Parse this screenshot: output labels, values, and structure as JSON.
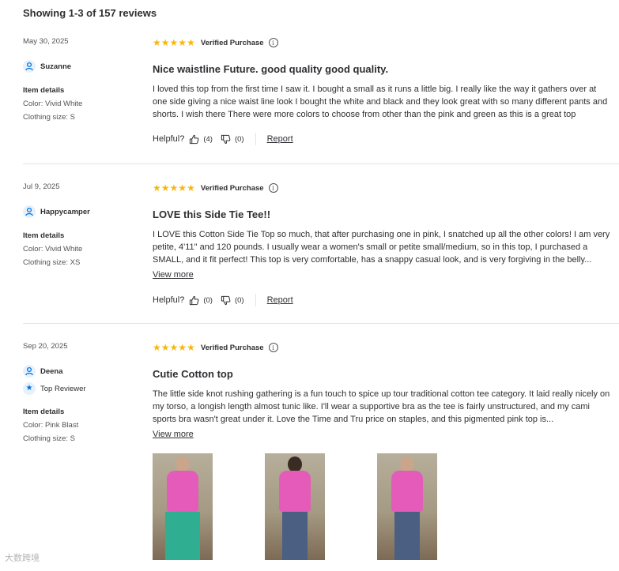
{
  "summary": "Showing 1-3 of 157 reviews",
  "icons": {
    "user": "user-icon",
    "badge": "star-badge-icon",
    "info": "info-icon",
    "thumbs_up": "thumbs-up-icon",
    "thumbs_down": "thumbs-down-icon"
  },
  "colors": {
    "star": "#f8b70b",
    "accent": "#0071dc"
  },
  "reviews": [
    {
      "date": "May 30, 2025",
      "user": "Suzanne",
      "badge": "",
      "details_heading": "Item details",
      "color": "Color: Vivid White",
      "size": "Clothing size: S",
      "rating": 5,
      "verified": "Verified Purchase",
      "title": "Nice waistline Future. good quality good quality.",
      "body": "I loved this top from the first time I saw it. I bought a small as it runs a little big. I really like the way it gathers over at one side giving a nice waist line look I bought the white and black and they look great with so many different pants and shorts. I wish there There were more colors to choose from other than the pink and green as this is a great top",
      "view_more": "",
      "helpful_label": "Helpful?",
      "up_count": "(4)",
      "down_count": "(0)",
      "report": "Report"
    },
    {
      "date": "Jul 9, 2025",
      "user": "Happycamper",
      "badge": "",
      "details_heading": "Item details",
      "color": "Color: Vivid White",
      "size": "Clothing size: XS",
      "rating": 5,
      "verified": "Verified Purchase",
      "title": "LOVE this Side Tie Tee!!",
      "body": "I LOVE this Cotton Side Tie Top so much, that after purchasing one in pink, I snatched up all the other colors! I am very petite, 4'11\" and 120 pounds. I usually wear a women's small or petite small/medium, so in this top, I purchased a SMALL, and it fit perfect! This top is very comfortable, has a snappy casual look, and is very forgiving in the belly...",
      "view_more": "View more",
      "helpful_label": "Helpful?",
      "up_count": "(0)",
      "down_count": "(0)",
      "report": "Report"
    },
    {
      "date": "Sep 20, 2025",
      "user": "Deena",
      "badge": "Top Reviewer",
      "details_heading": "Item details",
      "color": "Color: Pink Blast",
      "size": "Clothing size: S",
      "rating": 5,
      "verified": "Verified Purchase",
      "title": "Cutie Cotton top",
      "body": "The little side knot rushing gathering is a fun touch to spice up tour traditional cotton tee category. It laid really nicely on my torso, a longish length almost tunic like. I'll wear a supportive bra as the tee is fairly unstructured, and my cami sports bra wasn't great under it. Love the Time and Tru price on staples, and this pigmented pink top is...",
      "view_more": "View more",
      "helpful_label": "",
      "up_count": "",
      "down_count": "",
      "report": ""
    }
  ],
  "watermark": "大数跨境"
}
